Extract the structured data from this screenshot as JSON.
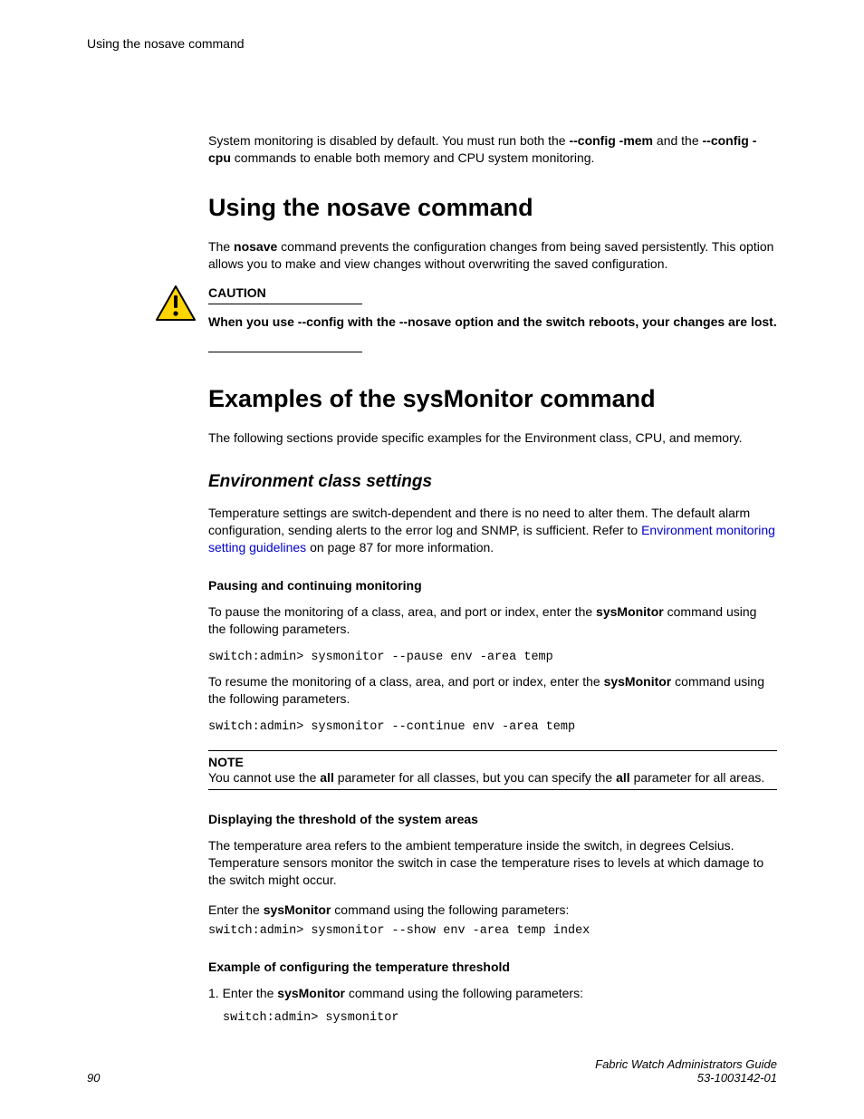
{
  "header": {
    "running_title": "Using the nosave command"
  },
  "intro": {
    "text_before_b1": "System monitoring is disabled by default. You must run both the ",
    "b1": "--config -mem",
    "mid": " and the ",
    "b2": "--config -cpu",
    "after": " commands to enable both memory and CPU system monitoring."
  },
  "sec_nosave": {
    "heading": "Using the nosave command",
    "p1_before": "The ",
    "p1_b": "nosave",
    "p1_after": " command prevents the configuration changes from being saved persistently. This option allows you to make and view changes without overwriting the saved configuration.",
    "caution_label": "CAUTION",
    "caution_text": "When you use --config with the --nosave option and the switch reboots, your changes are lost."
  },
  "sec_examples": {
    "heading": "Examples of the sysMonitor command",
    "p1": "The following sections provide specific examples for the Environment class, CPU, and memory."
  },
  "sec_env": {
    "heading": "Environment class settings",
    "p1_before_link": "Temperature settings are switch-dependent and there is no need to alter them. The default alarm configuration, sending alerts to the error log and SNMP, is sufficient. Refer to ",
    "link_text": "Environment monitoring setting guidelines",
    "p1_after_link": " on page 87 for more information."
  },
  "sec_pause": {
    "heading": "Pausing and continuing monitoring",
    "p1_before": "To pause the monitoring of a class, area, and port or index, enter the ",
    "p1_b": "sysMonitor",
    "p1_after": " command using the following parameters.",
    "code1": "switch:admin> sysmonitor --pause env -area temp",
    "p2_before": "To resume the monitoring of a class, area, and port or index, enter the ",
    "p2_b": "sysMonitor",
    "p2_after": " command using the following parameters.",
    "code2": "switch:admin> sysmonitor --continue env -area temp"
  },
  "note": {
    "label": "NOTE",
    "before1": "You cannot use the ",
    "b1": "all",
    "mid": " parameter for all classes, but you can specify the ",
    "b2": "all",
    "after": " parameter for all areas."
  },
  "sec_threshold": {
    "heading": "Displaying the threshold of the system areas",
    "p1": "The temperature area refers to the ambient temperature inside the switch, in degrees Celsius. Temperature sensors monitor the switch in case the temperature rises to levels at which damage to the switch might occur.",
    "p2_before": "Enter the ",
    "p2_b": "sysMonitor",
    "p2_after": " command using the following parameters:",
    "code": "switch:admin> sysmonitor --show env -area temp index"
  },
  "sec_config": {
    "heading": "Example of configuring the temperature threshold",
    "li_num": "1.",
    "li_before": " Enter the ",
    "li_b": "sysMonitor",
    "li_after": " command using the following parameters:",
    "code": "switch:admin> sysmonitor"
  },
  "footer": {
    "page": "90",
    "title": "Fabric Watch Administrators Guide",
    "doc_id": "53-1003142-01"
  }
}
